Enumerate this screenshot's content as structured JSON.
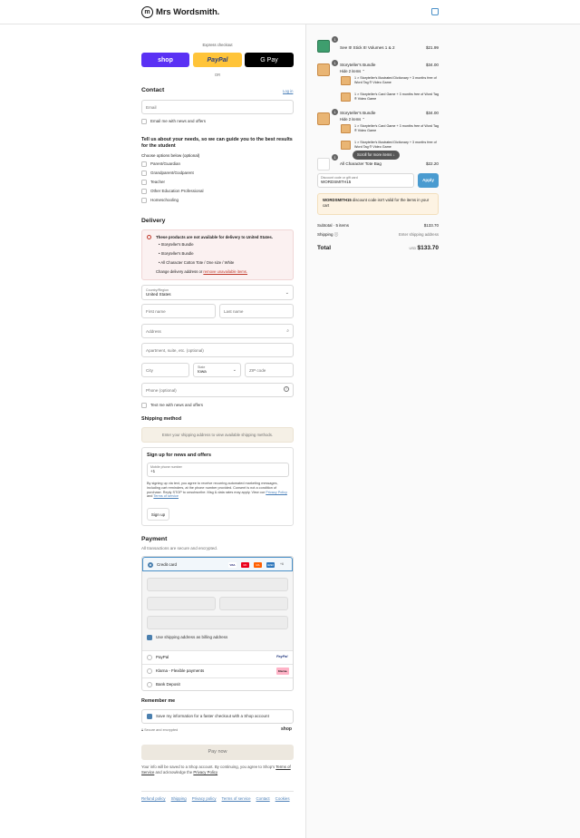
{
  "brand": {
    "name": "Mrs Wordsmith."
  },
  "express": {
    "title": "Express checkout",
    "shop": "shop",
    "paypal": "PayPal",
    "gpay": "G Pay",
    "or": "OR"
  },
  "contact": {
    "title": "Contact",
    "login": "Log in",
    "email_placeholder": "Email",
    "news": "Email me with news and offers"
  },
  "needs": {
    "title": "Tell us about your needs, so we can guide you to the best results for the student",
    "subtitle": "Choose options below (optional)",
    "options": [
      "Parent/Guardian",
      "Grandparent/Godparent",
      "Teacher",
      "Other Education Professional",
      "Homeschooling"
    ]
  },
  "delivery": {
    "title": "Delivery",
    "warn_title": "These products are not available for delivery to United States.",
    "warn_items": [
      "Storyteller's Bundle",
      "Storyteller's Bundle",
      "All Character Cotton Tote / One size / White"
    ],
    "warn_change": "Change delivery address or",
    "warn_remove": "remove unavailable items.",
    "country_label": "Country/Region",
    "country": "United States",
    "first": "First name",
    "last": "Last name",
    "address": "Address",
    "apt": "Apartment, suite, etc. (optional)",
    "city": "City",
    "state_label": "State",
    "state": "Iowa",
    "zip": "ZIP code",
    "phone": "Phone (optional)",
    "text_news": "Text me with news and offers"
  },
  "shipping": {
    "title": "Shipping method",
    "placeholder": "Enter your shipping address to view available shipping methods."
  },
  "signup": {
    "title": "Sign up for news and offers",
    "phone_label": "Mobile phone number",
    "phone": "+1",
    "legal": "By signing up via text, you agree to receive recurring automated marketing messages, including cart reminders, at the phone number provided. Consent is not a condition of purchase. Reply STOP to unsubscribe. Msg & data rates may apply. View our",
    "privacy": "Privacy Policy",
    "and": "and",
    "terms": "Terms of service",
    "button": "Sign up"
  },
  "payment": {
    "title": "Payment",
    "subtitle": "All transactions are secure and encrypted.",
    "credit": "Credit card",
    "cards": [
      "VISA",
      "MC",
      "MA",
      "AMEX",
      "+6"
    ],
    "billing": "Use shipping address as billing address",
    "paypal": "PayPal",
    "paypal_logo": "PayPal",
    "klarna": "Klarna - Flexible payments",
    "klarna_logo": "Klarna.",
    "bank": "Bank Deposit"
  },
  "remember": {
    "title": "Remember me",
    "save": "Save my information for a faster checkout with a Shop account",
    "secure": "Secure and encrypted",
    "shop": "shop"
  },
  "paynow": {
    "label": "Pay now",
    "note1": "Your info will be saved to a Shop account. By continuing, you agree to Shop's",
    "tos": "Terms of Service",
    "note2": "and acknowledge the",
    "privacy": "Privacy Policy"
  },
  "footer": [
    "Refund policy",
    "Shipping",
    "Privacy policy",
    "Terms of service",
    "Contact",
    "Cookies"
  ],
  "cart": {
    "items": [
      {
        "qty": "1",
        "name": "See It! Stick It! Volumes 1 & 2",
        "price": "$21.99"
      },
      {
        "qty": "1",
        "name": "Storyteller's Bundle",
        "price": "$34.00",
        "hide": "Hide 2 items",
        "subs": [
          "1 × Storyteller's Illustrated Dictionary + 3 months free of Word Tag ® Video Game",
          "1 × Storyteller's Card Game + 3 months free of Word Tag ® Video Game"
        ]
      },
      {
        "qty": "1",
        "name": "Storyteller's Bundle",
        "price": "$34.00",
        "hide": "Hide 2 items",
        "subs": [
          "1 × Storyteller's Card Game + 3 months free of Word Tag ® Video Game",
          "1 × Storyteller's Illustrated Dictionary + 3 months free of Word Tag ® Video Game"
        ]
      },
      {
        "qty": "1",
        "name": "All Character Tote Bag",
        "price": "$22.20"
      }
    ],
    "scroll": "Scroll for more items",
    "discount_label": "Discount code or gift card",
    "discount": "WORDSMITH15",
    "apply": "Apply",
    "error_code": "WORDSMITH15",
    "error_text": "discount code isn't valid for the items in your cart",
    "subtotal_label": "Subtotal · 5 items",
    "subtotal": "$133.70",
    "shipping_label": "Shipping",
    "shipping": "Enter shipping address",
    "total_label": "Total",
    "currency": "USD",
    "total": "$133.70"
  }
}
